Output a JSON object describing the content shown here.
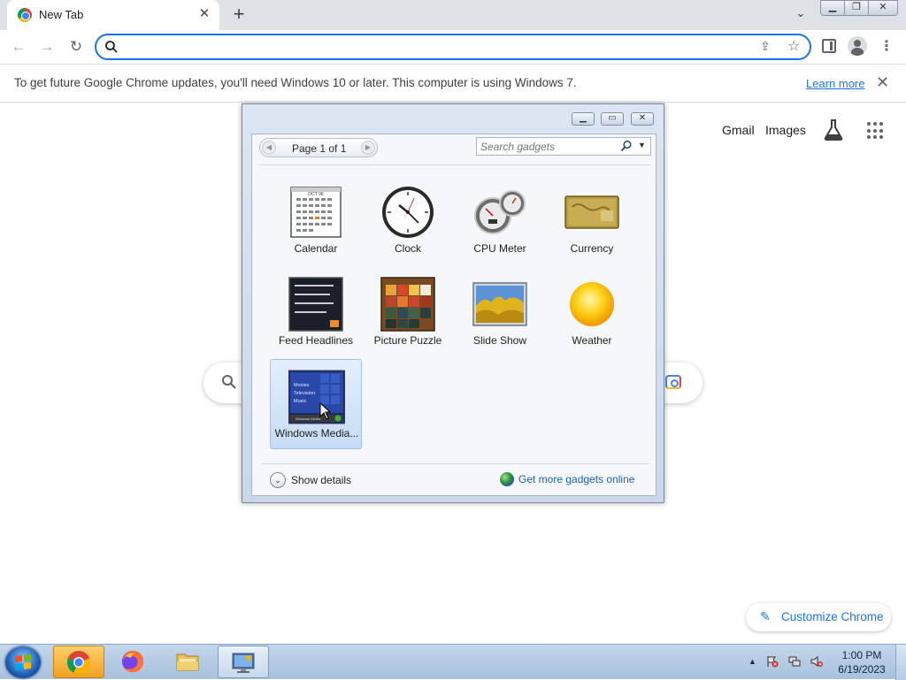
{
  "tab": {
    "title": "New Tab",
    "close": "✕",
    "new_tab": "+",
    "search_tabs": "⌄"
  },
  "window_buttons": {
    "min": "▁",
    "max": "❐",
    "close": "✕"
  },
  "toolbar": {
    "back": "←",
    "forward": "→",
    "reload": "↻",
    "omnibox_value": "",
    "menu": "⋮",
    "share": "⇪",
    "star": "☆"
  },
  "infobar": {
    "text": "To get future Google Chrome updates, you'll need Windows 10 or later. This computer is using Windows 7.",
    "link": "Learn more",
    "close": "✕"
  },
  "ntp": {
    "links": {
      "gmail": "Gmail",
      "images": "Images"
    },
    "search_placeholder": "",
    "customize_label": "Customize Chrome",
    "customize_icon": "✎"
  },
  "gadgets_window": {
    "pager_text": "Page 1 of 1",
    "prev": "◀",
    "next": "▶",
    "search_placeholder": "Search gadgets",
    "search_dropdown": "▼",
    "controls": {
      "min": "▁",
      "max": "▭",
      "close": "✕"
    },
    "gadgets": [
      {
        "label": "Calendar",
        "icon": "calendar-gadget-icon"
      },
      {
        "label": "Clock",
        "icon": "clock-gadget-icon"
      },
      {
        "label": "CPU Meter",
        "icon": "cpu-meter-gadget-icon"
      },
      {
        "label": "Currency",
        "icon": "currency-gadget-icon"
      },
      {
        "label": "Feed Headlines",
        "icon": "feed-headlines-gadget-icon"
      },
      {
        "label": "Picture Puzzle",
        "icon": "picture-puzzle-gadget-icon"
      },
      {
        "label": "Slide Show",
        "icon": "slide-show-gadget-icon"
      },
      {
        "label": "Weather",
        "icon": "weather-gadget-icon"
      },
      {
        "label": "Windows Media...",
        "icon": "windows-media-gadget-icon",
        "selected": true
      }
    ],
    "calendar_month": "OCT 06",
    "media_lines": [
      "Movies",
      "Television",
      "Music"
    ],
    "media_footer": "Windows Media",
    "show_details": "Show details",
    "show_details_icon": "⌄",
    "get_more": "Get more gadgets online"
  },
  "taskbar": {
    "items": [
      "start-button",
      "chrome",
      "firefox",
      "windows-explorer",
      "desktop-gadgets"
    ],
    "tray_up": "▲",
    "clock_time": "1:00 PM",
    "clock_date": "6/19/2023"
  },
  "colors": {
    "chrome_tabstrip": "#dee1e6",
    "omnibox_focus": "#1a73e8",
    "link_blue": "#1a73e8",
    "gadget_window": "#dce6f2",
    "taskbar": "#b8cde4"
  }
}
